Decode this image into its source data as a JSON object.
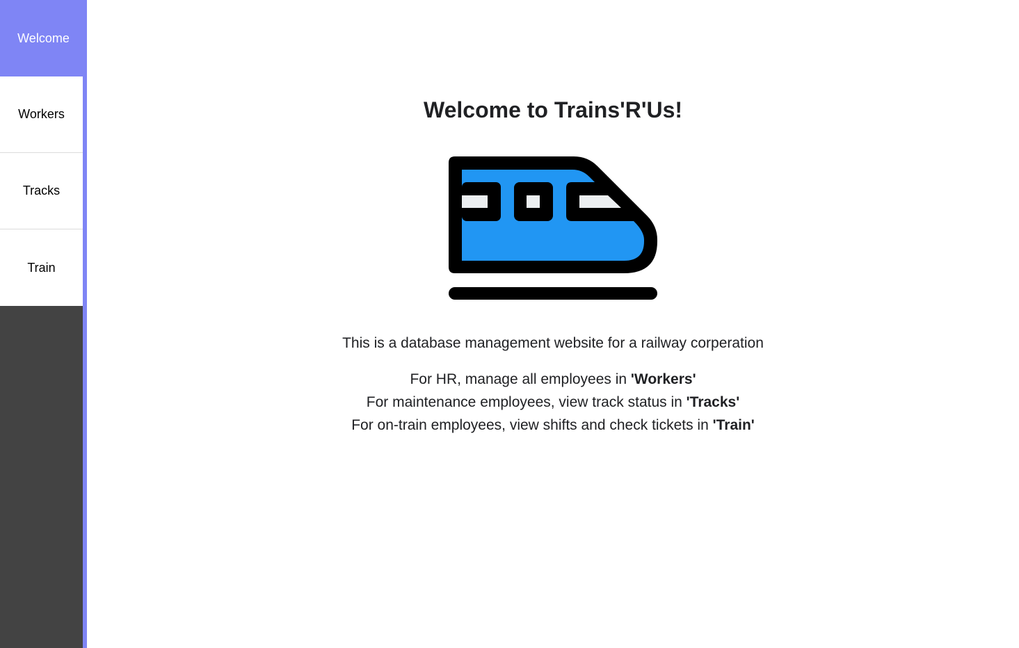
{
  "sidebar": {
    "items": [
      {
        "label": "Welcome",
        "active": true
      },
      {
        "label": "Workers",
        "active": false
      },
      {
        "label": "Tracks",
        "active": false
      },
      {
        "label": "Train",
        "active": false
      }
    ]
  },
  "main": {
    "title": "Welcome to Trains'R'Us!",
    "intro": "This is a database management website for a railway corperation",
    "lines": [
      {
        "text": "For HR, manage all employees in ",
        "bold": "'Workers'"
      },
      {
        "text": "For maintenance employees, view track status in ",
        "bold": "'Tracks'"
      },
      {
        "text": "For on-train employees, view shifts and check tickets in ",
        "bold": "'Train'"
      }
    ],
    "logo_icon": "train-icon"
  },
  "colors": {
    "accent": "#7f85f5",
    "sidebar_bg": "#434343",
    "train_blue": "#2196f3",
    "window_gray": "#eceff1"
  }
}
